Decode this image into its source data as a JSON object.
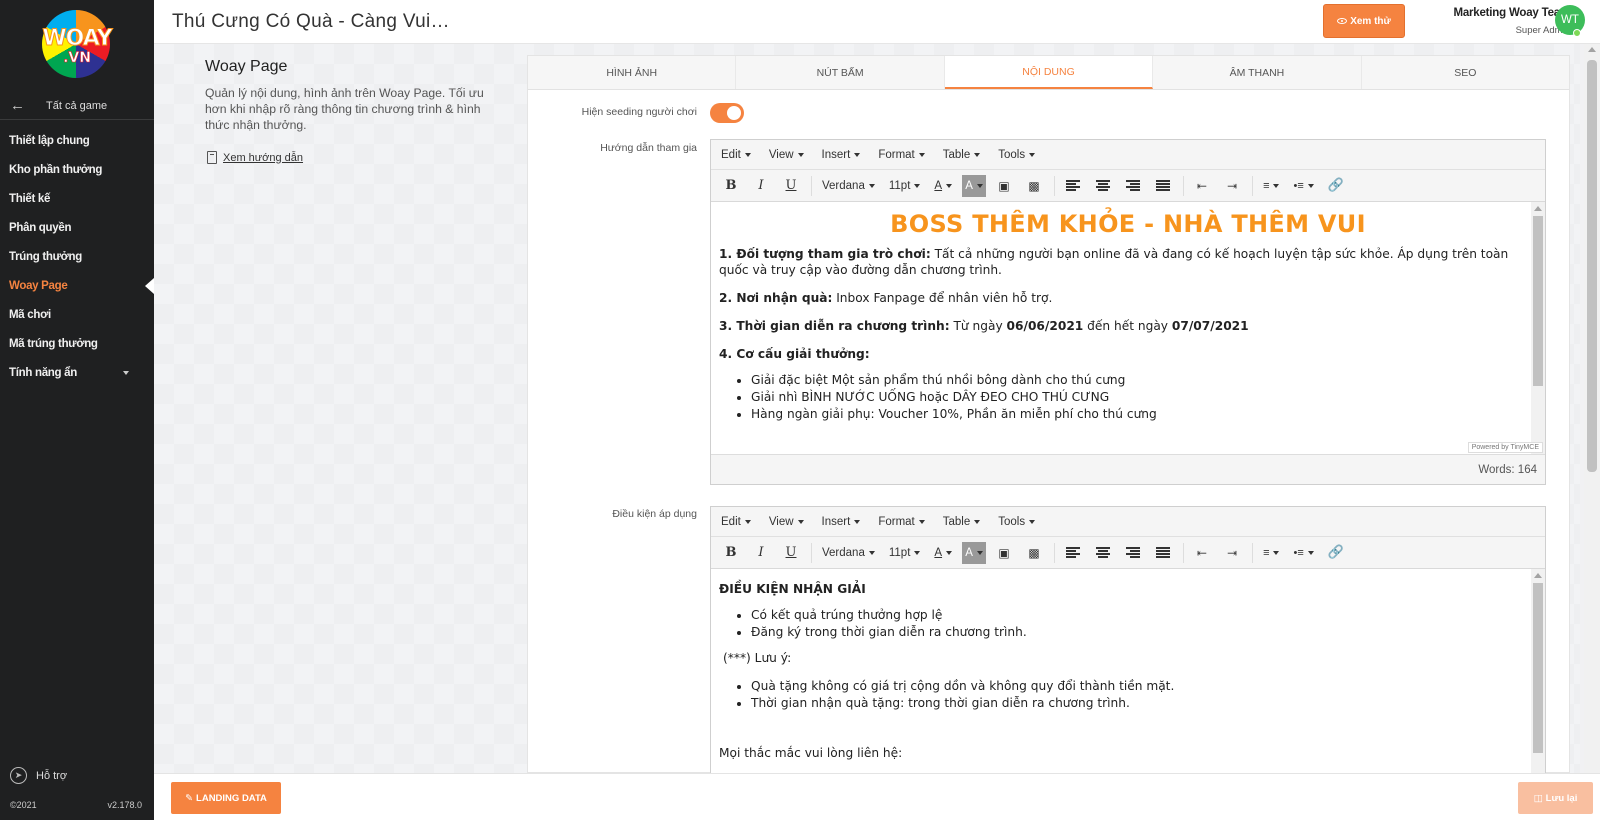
{
  "sidebar": {
    "logo_text": "WOAY",
    "logo_sub": ".VN",
    "back_label": "Tất cả game",
    "items": [
      {
        "label": "Thiết lập chung"
      },
      {
        "label": "Kho phần thưởng"
      },
      {
        "label": "Thiết kế"
      },
      {
        "label": "Phân quyền"
      },
      {
        "label": "Trúng thưởng"
      },
      {
        "label": "Woay Page"
      },
      {
        "label": "Mã chơi"
      },
      {
        "label": "Mã trúng thưởng"
      },
      {
        "label": "Tính năng ẩn"
      }
    ],
    "support_label": "Hỗ trợ",
    "copyright": "©2021",
    "version": "v2.178.0"
  },
  "header": {
    "title": "Thú Cưng Có Quà - Càng Vui…",
    "preview_button": "Xem thử",
    "user_name": "Marketing Woay Team",
    "user_role": "Super Admin",
    "avatar_initials": "WT"
  },
  "intro": {
    "heading": "Woay Page",
    "description": "Quản lý nội dung, hình ảnh trên Woay Page. Tối ưu hơn khi nhập rõ ràng thông tin chương trình & hình thức nhận thưởng.",
    "guide_link": "Xem hướng dẫn"
  },
  "tabs": [
    {
      "label": "HÌNH ẢNH"
    },
    {
      "label": "NÚT BẤM"
    },
    {
      "label": "NỘI DUNG"
    },
    {
      "label": "ÂM THANH"
    },
    {
      "label": "SEO"
    }
  ],
  "seeding": {
    "label": "Hiện seeding người chơi",
    "enabled": true
  },
  "editor_menu": [
    "Edit",
    "View",
    "Insert",
    "Format",
    "Table",
    "Tools"
  ],
  "editor_toolbar": {
    "font": "Verdana",
    "size": "11pt"
  },
  "guide_field": {
    "label": "Hướng dẫn tham gia",
    "doc_title": "BOSS THÊM KHỎE - NHÀ THÊM VUI",
    "p1_bold": "1. Đối tượng tham gia trò chơi:",
    "p1_text": " Tất cả những người bạn online đã và đang có kế hoạch luyện tập sức khỏe. Áp dụng trên toàn quốc và truy cập vào đường dẫn chương trình.",
    "p2_bold": "2. Nơi nhận quà:",
    "p2_text": " Inbox Fanpage để nhân viên hỗ trợ.",
    "p3_bold": "3. Thời gian diễn ra chương trình:",
    "p3_text1": " Từ ngày ",
    "p3_date1": "06/06/2021",
    "p3_text2": " đến hết ngày ",
    "p3_date2": "07/07/2021",
    "p4_bold": "4. Cơ cấu giải thưởng:",
    "prizes": [
      "Giải đặc biệt Một sản phẩm thú nhồi bông dành cho thú cưng",
      "Giải nhì BÌNH NƯỚC UỐNG hoặc DÂY ĐEO CHO THÚ CƯNG",
      "Hàng ngàn giải phụ: Voucher 10%, Phần ăn miễn phí cho thú cưng"
    ],
    "powered": "Powered by TinyMCE",
    "words": "Words: 164"
  },
  "condition_field": {
    "label": "Điều kiện áp dụng",
    "heading": "ĐIỀU KIỆN NHẬN GIẢI",
    "items": [
      "Có kết quả trúng thưởng hợp lệ",
      "Đăng ký trong thời gian diễn ra chương trình."
    ],
    "note": "(***) Lưu ý:",
    "notes": [
      "Quà tặng không có giá trị cộng dồn và không quy đổi thành tiền mặt.",
      "Thời gian nhận quà tặng: trong thời gian diễn ra chương trình."
    ],
    "contact": "Mọi thắc mắc vui lòng liên hệ:"
  },
  "footer": {
    "landing_button": "LANDING DATA",
    "save_button": "Lưu lại"
  },
  "colors": {
    "accent": "#f58340",
    "sidebar": "#1f2021",
    "title_orange": "#f7941d"
  }
}
